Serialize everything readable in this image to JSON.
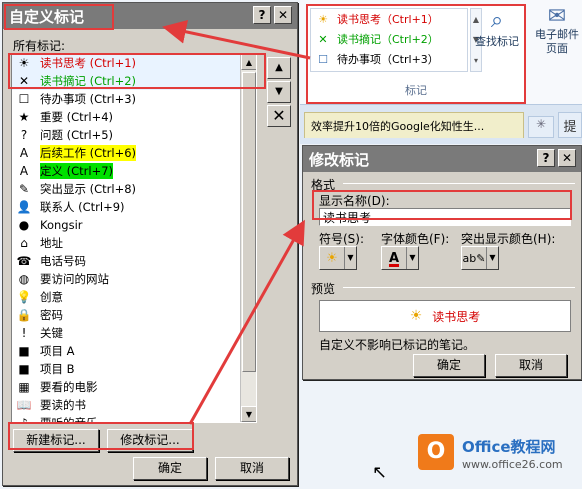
{
  "ribbon": {
    "tags_group_caption": "标记",
    "tags_gallery": [
      {
        "icon": "☀",
        "label": "读书思考（Ctrl+1）",
        "color": "#d40000"
      },
      {
        "icon": "✕",
        "label": "读书摘记（Ctrl+2）",
        "color": "#00a000"
      },
      {
        "icon": "☐",
        "label": "待办事项（Ctrl+3）",
        "color": "#000000"
      }
    ],
    "find_tags_label": "查找标记",
    "email_page_label_1": "电子邮件",
    "email_page_label_2": "页面",
    "page_tab_title": "效率提升10倍的Google化知性生...",
    "page_tab2": "✳",
    "page_tab3": "提"
  },
  "customize_dialog": {
    "title": "自定义标记",
    "help_button": "?",
    "close_button": "✕",
    "all_tags_label": "所有标记:",
    "tags": [
      {
        "icon": "☀",
        "label": "读书思考 (Ctrl+1)",
        "color": "#d40000",
        "highlight": ""
      },
      {
        "icon": "✕",
        "label": "读书摘记 (Ctrl+2)",
        "color": "#00a000",
        "highlight": ""
      },
      {
        "icon": "☐",
        "label": "待办事项 (Ctrl+3)",
        "color": "#000000",
        "highlight": ""
      },
      {
        "icon": "★",
        "label": "重要 (Ctrl+4)",
        "color": "#000000",
        "highlight": ""
      },
      {
        "icon": "?",
        "label": "问题 (Ctrl+5)",
        "color": "#000000",
        "highlight": ""
      },
      {
        "icon": "A",
        "label": "后续工作 (Ctrl+6)",
        "color": "#000000",
        "highlight": "#ffff00"
      },
      {
        "icon": "A",
        "label": "定义 (Ctrl+7)",
        "color": "#000000",
        "highlight": "#00e000"
      },
      {
        "icon": "✎",
        "label": "突出显示 (Ctrl+8)",
        "color": "#000000",
        "highlight": ""
      },
      {
        "icon": "👤",
        "label": "联系人 (Ctrl+9)",
        "color": "#000000",
        "highlight": ""
      },
      {
        "icon": "●",
        "label": "Kongsir",
        "color": "#000000",
        "highlight": ""
      },
      {
        "icon": "⌂",
        "label": "地址",
        "color": "#000000",
        "highlight": ""
      },
      {
        "icon": "☎",
        "label": "电话号码",
        "color": "#000000",
        "highlight": ""
      },
      {
        "icon": "◍",
        "label": "要访问的网站",
        "color": "#000000",
        "highlight": ""
      },
      {
        "icon": "💡",
        "label": "创意",
        "color": "#000000",
        "highlight": ""
      },
      {
        "icon": "🔒",
        "label": "密码",
        "color": "#000000",
        "highlight": ""
      },
      {
        "icon": "!",
        "label": "关键",
        "color": "#000000",
        "highlight": ""
      },
      {
        "icon": "■",
        "label": "项目 A",
        "color": "#000000",
        "highlight": ""
      },
      {
        "icon": "■",
        "label": "项目 B",
        "color": "#000000",
        "highlight": ""
      },
      {
        "icon": "▦",
        "label": "要看的电影",
        "color": "#000000",
        "highlight": ""
      },
      {
        "icon": "📖",
        "label": "要读的书",
        "color": "#000000",
        "highlight": ""
      },
      {
        "icon": "♪",
        "label": "要听的音乐",
        "color": "#000000",
        "highlight": ""
      }
    ],
    "new_tag_button": "新建标记...",
    "modify_tag_button": "修改标记...",
    "ok_button": "确定",
    "cancel_button": "取消"
  },
  "modify_dialog": {
    "title": "修改标记",
    "help_button": "?",
    "close_button": "✕",
    "format_label": "格式",
    "display_name_label": "显示名称(D):",
    "display_name_value": "读书思考",
    "symbol_label": "符号(S):",
    "font_color_label": "字体颜色(F):",
    "highlight_color_label": "突出显示颜色(H):",
    "preview_label": "预览",
    "preview_text": "读书思考",
    "note": "自定义不影响已标记的笔记。",
    "ok_button": "确定",
    "cancel_button": "取消"
  },
  "watermark": {
    "title": "Office教程网",
    "subtitle": "www.office26.com"
  }
}
